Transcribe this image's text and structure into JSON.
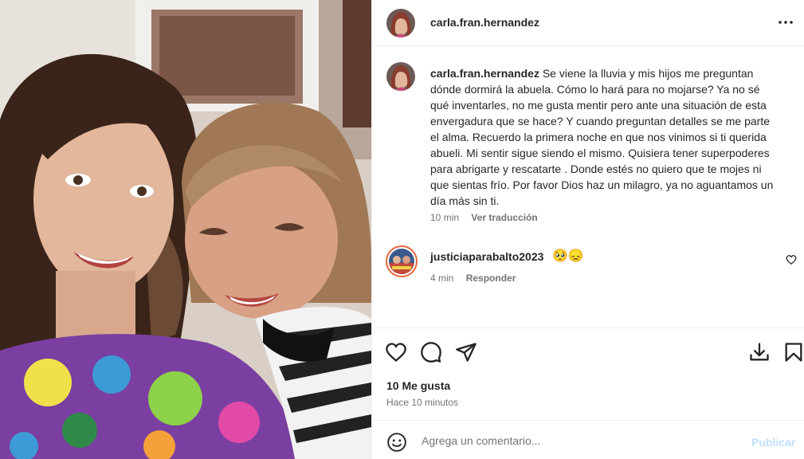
{
  "post": {
    "username": "carla.fran.hernandez",
    "more_icon": "more-horizontal-icon"
  },
  "caption": {
    "username": "carla.fran.hernandez",
    "text": "Se viene la lluvia y mis hijos me preguntan dónde dormirá la abuela. Cómo lo hará para no mojarse? Ya no sé qué inventarles, no me gusta mentir pero ante una situación de esta envergadura que se hace? Y cuando preguntan detalles se me parte el alma. Recuerdo la primera noche en que nos vinimos si ti querida abueli. Mi sentir sigue siendo el mismo. Quisiera tener superpoderes para abrigarte y rescatarte . Donde estés no quiero que te mojes ni que sientas frío. Por favor Dios haz un milagro, ya no aguantamos un día más sin ti.",
    "time": "10 min",
    "translate_label": "Ver traducción"
  },
  "comment": {
    "username": "justiciaparabalto2023",
    "emojis": "🥺😞",
    "time": "4 min",
    "reply_label": "Responder"
  },
  "actions": {
    "icons": [
      "heart-icon",
      "comment-icon",
      "share-icon",
      "download-icon",
      "bookmark-icon"
    ],
    "likes": "10 Me gusta",
    "posted": "Hace 10 minutos"
  },
  "add_comment": {
    "placeholder": "Agrega un comentario...",
    "publish_label": "Publicar"
  },
  "colors": {
    "text": "#262626",
    "secondary": "#737373",
    "publish_disabled": "#c0dffd",
    "border": "#efefef"
  }
}
